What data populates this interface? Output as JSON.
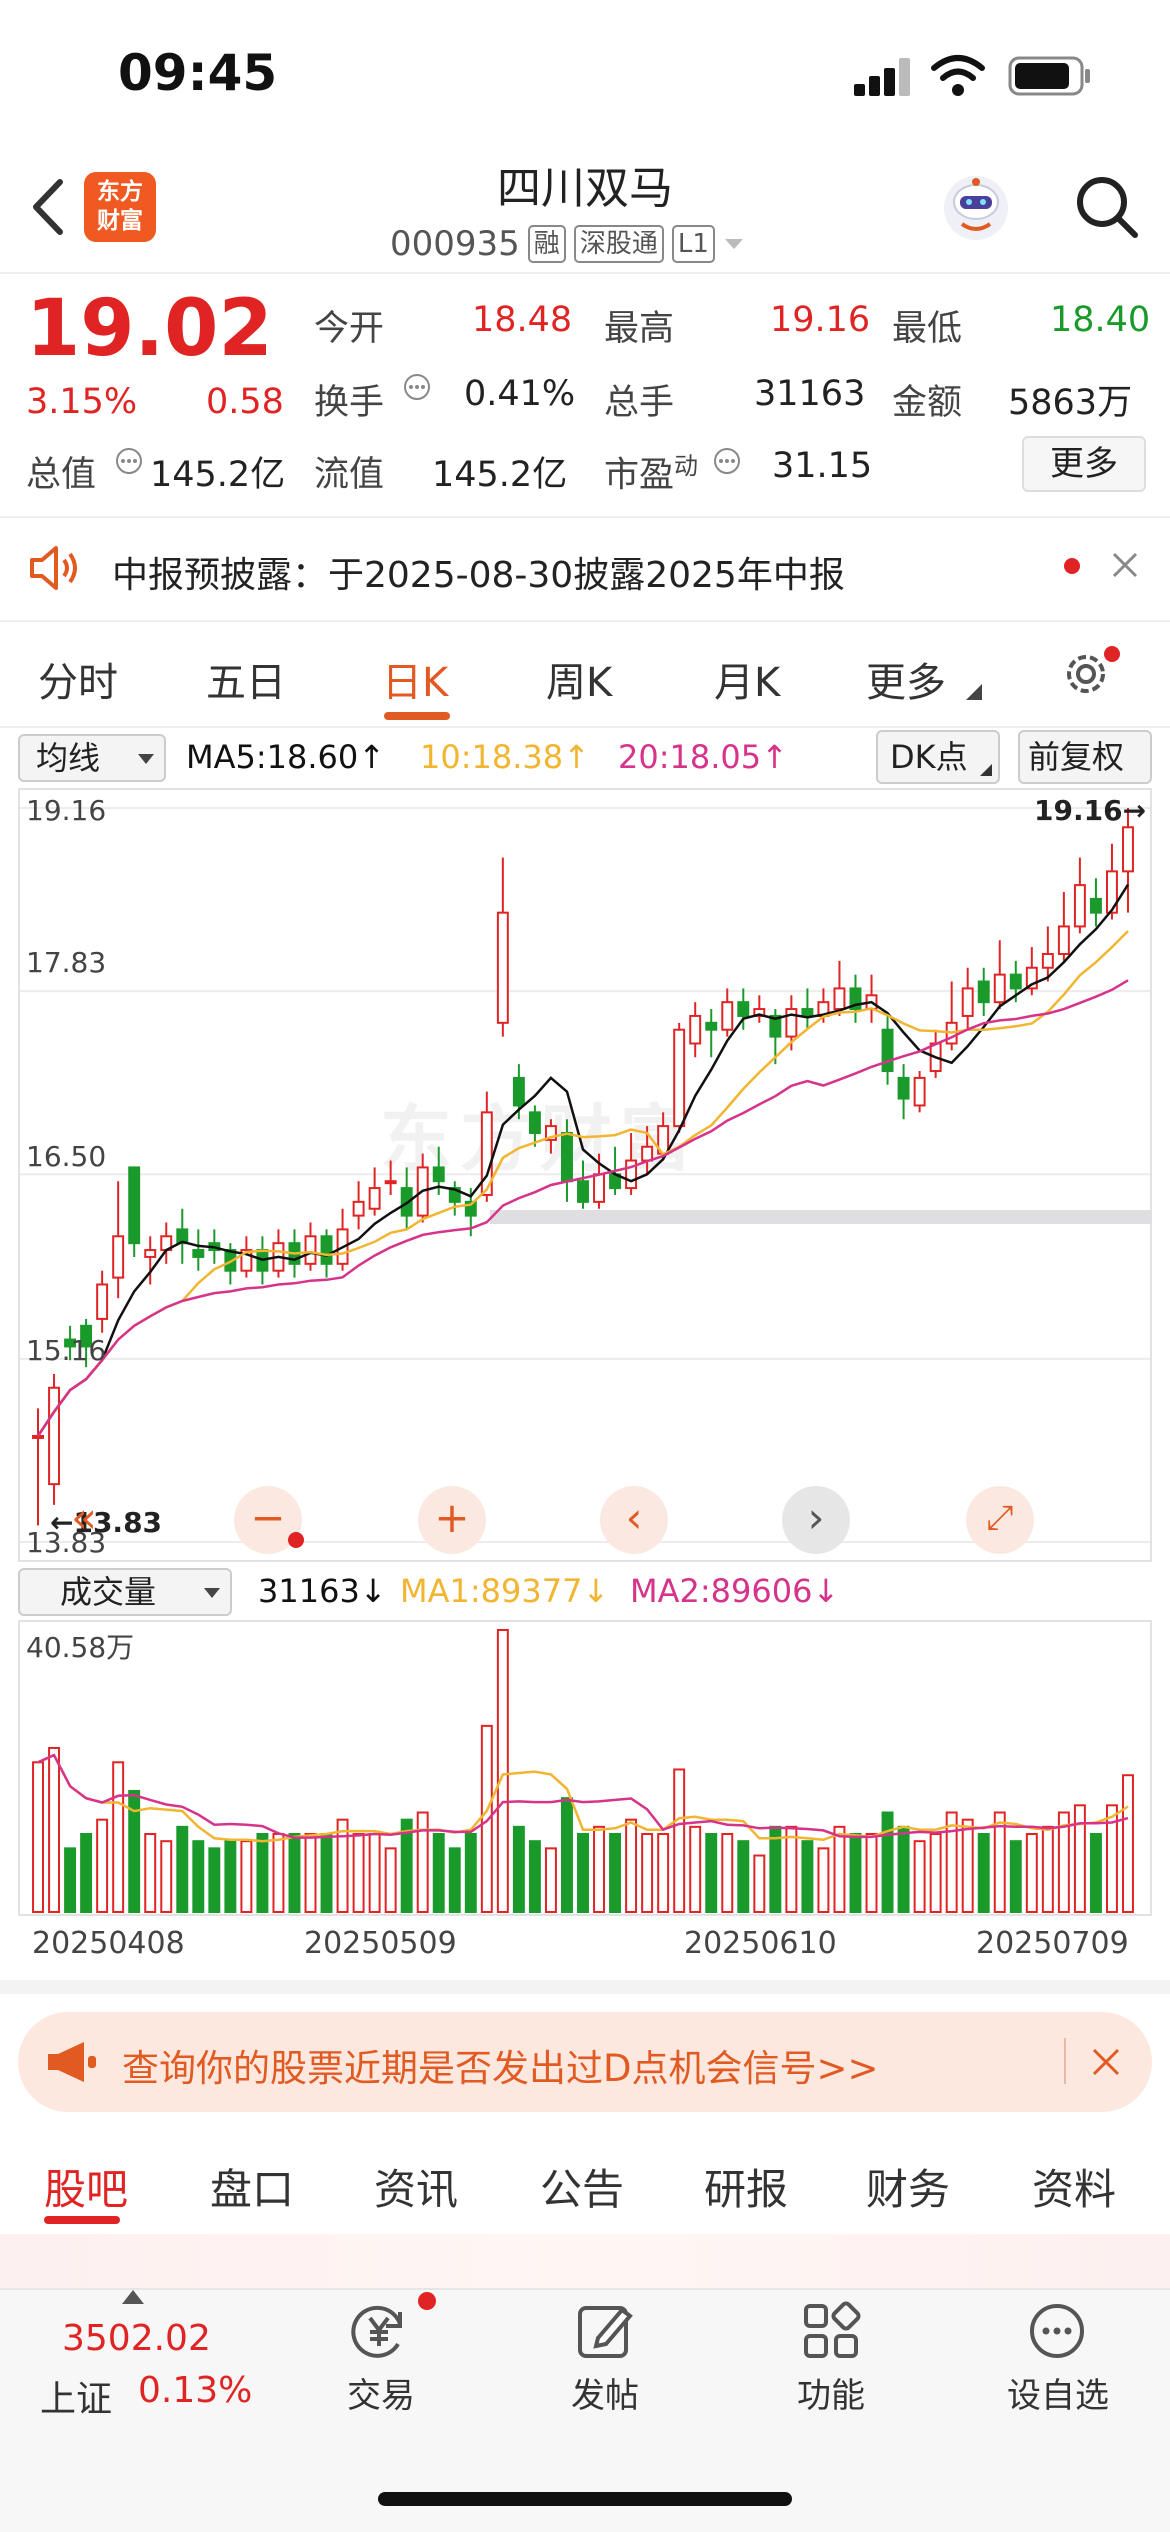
{
  "status_bar": {
    "time": "09:45"
  },
  "header": {
    "logo_line1": "东方",
    "logo_line2": "财富",
    "stock_name": "四川双马",
    "stock_code": "000935",
    "tags": [
      "融",
      "深股通",
      "L1"
    ]
  },
  "quote": {
    "price": "19.02",
    "change_pct": "3.15%",
    "change_amt": "0.58",
    "open_label": "今开",
    "open": "18.48",
    "high_label": "最高",
    "high": "19.16",
    "low_label": "最低",
    "low": "18.40",
    "turnover_label": "换手",
    "turnover": "0.41%",
    "volume_label": "总手",
    "volume": "31163",
    "amount_label": "金额",
    "amount": "5863万",
    "total_cap_label": "总值",
    "total_cap": "145.2亿",
    "float_cap_label": "流值",
    "float_cap": "145.2亿",
    "pe_label": "市盈",
    "pe_sup": "动",
    "pe": "31.15",
    "more_label": "更多"
  },
  "notice": {
    "text": "中报预披露：于2025-08-30披露2025年中报"
  },
  "chart_tabs": [
    "分时",
    "五日",
    "日K",
    "周K",
    "月K",
    "更多"
  ],
  "ma_bar": {
    "selector": "均线",
    "ma5": "MA5:18.60↑",
    "ma10": "10:18.38↑",
    "ma20": "20:18.05↑",
    "dk_label": "DK点",
    "fq_label": "前复权"
  },
  "kline_axis": {
    "y_labels": [
      "19.16",
      "17.83",
      "16.50",
      "15.16",
      "13.83"
    ],
    "max_marker": "19.16→",
    "min_marker": "←13.83"
  },
  "volume_bar": {
    "selector": "成交量",
    "vol": "31163↓",
    "ma1": "MA1:89377↓",
    "ma2": "MA2:89606↓",
    "y_max": "40.58万",
    "dates": [
      "20250408",
      "20250509",
      "20250610",
      "20250709"
    ]
  },
  "dpoint_banner": {
    "text": "查询你的股票近期是否发出过D点机会信号>>"
  },
  "content_tabs": [
    "股吧",
    "盘口",
    "资讯",
    "公告",
    "研报",
    "财务",
    "资料"
  ],
  "bottom_bar": {
    "index_value": "3502.02",
    "index_name": "上证",
    "index_change": "0.13%",
    "items": [
      "交易",
      "发帖",
      "功能",
      "设自选"
    ]
  },
  "colors": {
    "up": "#e02424",
    "down": "#1a9a2a",
    "accent": "#e05a22",
    "ma5": "#111111",
    "ma10": "#f2b531",
    "ma20": "#d6338a"
  },
  "chart_data": {
    "type": "candlestick",
    "y_range": [
      13.83,
      19.16
    ],
    "candles": [
      [
        14.6,
        14.6,
        14.8,
        13.95
      ],
      [
        14.25,
        14.95,
        15.05,
        14.1
      ],
      [
        15.3,
        15.25,
        15.4,
        15.15
      ],
      [
        15.4,
        15.25,
        15.45,
        15.1
      ],
      [
        15.45,
        15.7,
        15.8,
        15.35
      ],
      [
        15.75,
        16.05,
        16.45,
        15.6
      ],
      [
        16.55,
        16.0,
        16.55,
        15.9
      ],
      [
        15.9,
        15.95,
        16.05,
        15.7
      ],
      [
        15.95,
        16.05,
        16.15,
        15.85
      ],
      [
        16.1,
        16.0,
        16.25,
        15.85
      ],
      [
        15.95,
        15.9,
        16.1,
        15.8
      ],
      [
        16.0,
        15.95,
        16.1,
        15.85
      ],
      [
        15.95,
        15.8,
        16.0,
        15.7
      ],
      [
        15.8,
        15.95,
        16.05,
        15.75
      ],
      [
        15.95,
        15.8,
        16.05,
        15.7
      ],
      [
        15.8,
        16.0,
        16.1,
        15.75
      ],
      [
        16.0,
        15.85,
        16.1,
        15.75
      ],
      [
        15.85,
        16.05,
        16.15,
        15.8
      ],
      [
        16.05,
        15.85,
        16.1,
        15.75
      ],
      [
        15.85,
        16.1,
        16.25,
        15.8
      ],
      [
        16.2,
        16.3,
        16.45,
        16.1
      ],
      [
        16.25,
        16.4,
        16.55,
        16.2
      ],
      [
        16.45,
        16.45,
        16.6,
        16.35
      ],
      [
        16.4,
        16.2,
        16.55,
        16.1
      ],
      [
        16.2,
        16.55,
        16.65,
        16.15
      ],
      [
        16.55,
        16.45,
        16.7,
        16.35
      ],
      [
        16.4,
        16.3,
        16.45,
        16.2
      ],
      [
        16.3,
        16.2,
        16.4,
        16.05
      ],
      [
        16.35,
        16.95,
        17.1,
        16.3
      ],
      [
        17.6,
        18.4,
        18.8,
        17.5
      ],
      [
        17.2,
        17.0,
        17.3,
        16.9
      ],
      [
        16.95,
        16.8,
        17.0,
        16.7
      ],
      [
        16.75,
        16.85,
        16.9,
        16.65
      ],
      [
        16.8,
        16.45,
        16.9,
        16.3
      ],
      [
        16.45,
        16.3,
        16.6,
        16.25
      ],
      [
        16.3,
        16.5,
        16.65,
        16.25
      ],
      [
        16.5,
        16.4,
        16.7,
        16.35
      ],
      [
        16.4,
        16.6,
        16.8,
        16.35
      ],
      [
        16.6,
        16.7,
        16.85,
        16.5
      ],
      [
        16.65,
        16.85,
        16.95,
        16.6
      ],
      [
        16.85,
        17.55,
        17.6,
        16.8
      ],
      [
        17.45,
        17.65,
        17.75,
        17.35
      ],
      [
        17.6,
        17.55,
        17.7,
        17.35
      ],
      [
        17.55,
        17.75,
        17.85,
        17.5
      ],
      [
        17.75,
        17.65,
        17.85,
        17.55
      ],
      [
        17.65,
        17.7,
        17.8,
        17.6
      ],
      [
        17.65,
        17.5,
        17.7,
        17.3
      ],
      [
        17.5,
        17.7,
        17.8,
        17.4
      ],
      [
        17.7,
        17.65,
        17.85,
        17.55
      ],
      [
        17.65,
        17.75,
        17.85,
        17.6
      ],
      [
        17.7,
        17.85,
        18.05,
        17.65
      ],
      [
        17.85,
        17.7,
        17.95,
        17.6
      ],
      [
        17.7,
        17.8,
        17.95,
        17.6
      ],
      [
        17.55,
        17.25,
        17.65,
        17.15
      ],
      [
        17.2,
        17.05,
        17.3,
        16.9
      ],
      [
        17.0,
        17.2,
        17.25,
        16.95
      ],
      [
        17.25,
        17.45,
        17.55,
        17.2
      ],
      [
        17.45,
        17.6,
        17.9,
        17.4
      ],
      [
        17.65,
        17.85,
        18.0,
        17.55
      ],
      [
        17.9,
        17.75,
        18.0,
        17.65
      ],
      [
        17.75,
        17.95,
        18.2,
        17.7
      ],
      [
        17.95,
        17.85,
        18.05,
        17.75
      ],
      [
        17.85,
        18.0,
        18.15,
        17.8
      ],
      [
        18.0,
        18.1,
        18.3,
        17.9
      ],
      [
        18.1,
        18.3,
        18.55,
        18.05
      ],
      [
        18.3,
        18.6,
        18.8,
        18.25
      ],
      [
        18.5,
        18.4,
        18.65,
        18.3
      ],
      [
        18.4,
        18.7,
        18.9,
        18.35
      ],
      [
        18.7,
        19.02,
        19.16,
        18.4
      ]
    ],
    "volume_range": [
      0,
      405800
    ]
  }
}
